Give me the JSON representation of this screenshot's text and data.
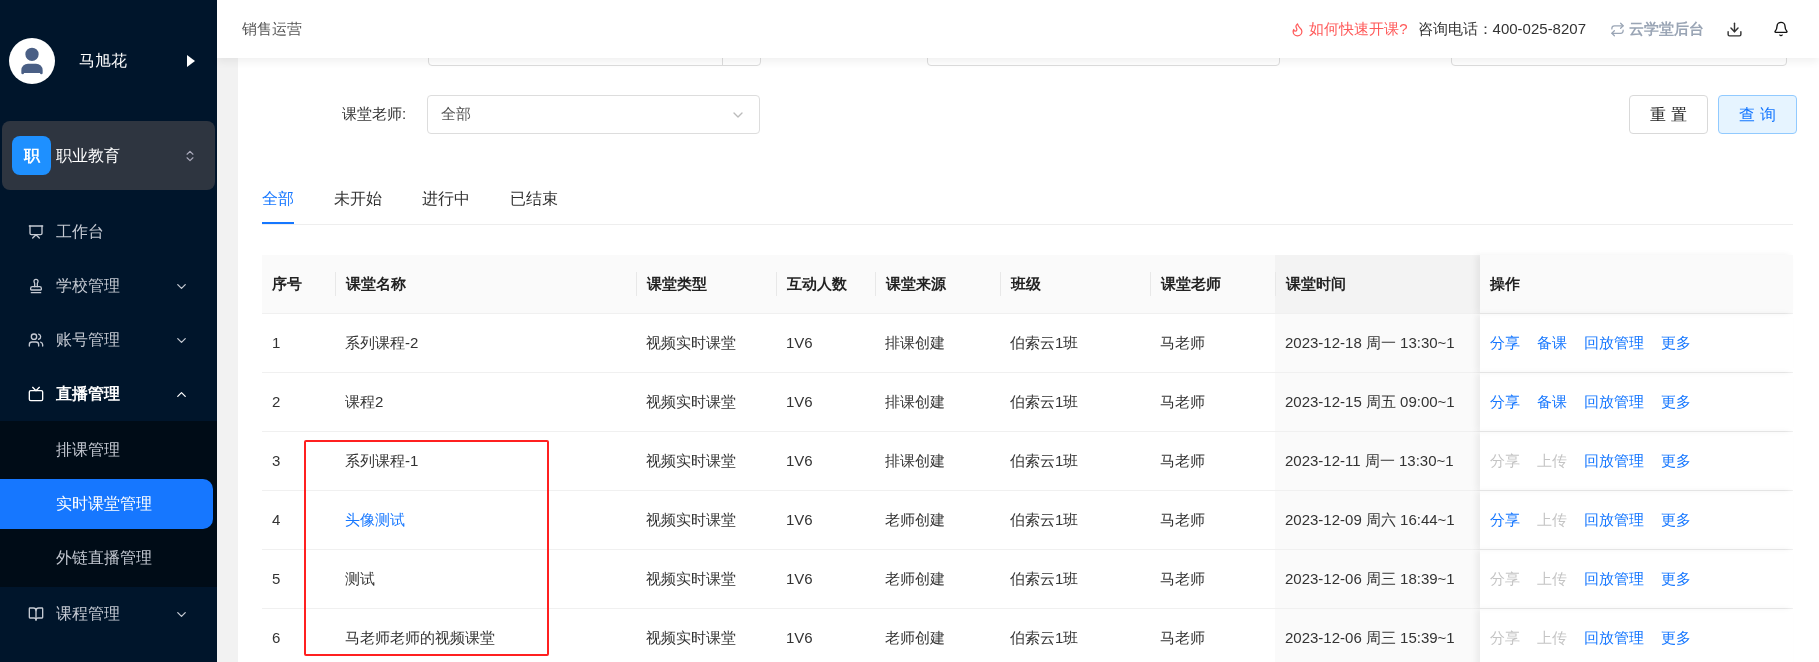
{
  "sidebar": {
    "user": {
      "name": "马旭花"
    },
    "org": {
      "badge": "职",
      "name": "职业教育"
    },
    "items": [
      {
        "kind": "workbench",
        "label": "工作台",
        "expanded": false,
        "has_children": false
      },
      {
        "kind": "school",
        "label": "学校管理",
        "expanded": false,
        "has_children": true
      },
      {
        "kind": "account",
        "label": "账号管理",
        "expanded": false,
        "has_children": true
      },
      {
        "kind": "live",
        "label": "直播管理",
        "expanded": true,
        "has_children": true,
        "children": [
          {
            "label": "排课管理",
            "selected": false
          },
          {
            "label": "实时课堂管理",
            "selected": true
          },
          {
            "label": "外链直播管理",
            "selected": false
          }
        ]
      },
      {
        "kind": "course",
        "label": "课程管理",
        "expanded": false,
        "has_children": true
      }
    ]
  },
  "header": {
    "breadcrumb": "销售运营",
    "help_link": "如何快速开课?",
    "phone": "咨询电话：400-025-8207",
    "backend_link": "云学堂后台"
  },
  "filters": {
    "teacher": {
      "label": "课堂老师:",
      "value": "全部"
    },
    "buttons": [
      {
        "kind": "reset",
        "label": "重 置"
      },
      {
        "kind": "query",
        "label": "查 询"
      }
    ]
  },
  "tabs": [
    {
      "label": "全部",
      "selected": true
    },
    {
      "label": "未开始",
      "selected": false
    },
    {
      "label": "进行中",
      "selected": false
    },
    {
      "label": "已结束",
      "selected": false
    }
  ],
  "table": {
    "columns": [
      "序号",
      "课堂名称",
      "课堂类型",
      "互动人数",
      "课堂来源",
      "班级",
      "课堂老师",
      "课堂时间",
      "操作"
    ],
    "rows": [
      {
        "cells": [
          "1",
          "系列课程-2",
          "视频实时课堂",
          "1V6",
          "排课创建",
          "伯索云1班",
          "马老师",
          "2023-12-18 周一 13:30~1"
        ],
        "name_link": false,
        "actions": [
          {
            "label": "分享",
            "disabled": false
          },
          {
            "label": "备课",
            "disabled": false
          },
          {
            "label": "回放管理",
            "disabled": false
          },
          {
            "label": "更多",
            "disabled": false
          }
        ]
      },
      {
        "cells": [
          "2",
          "课程2",
          "视频实时课堂",
          "1V6",
          "排课创建",
          "伯索云1班",
          "马老师",
          "2023-12-15 周五 09:00~1"
        ],
        "name_link": false,
        "actions": [
          {
            "label": "分享",
            "disabled": false
          },
          {
            "label": "备课",
            "disabled": false
          },
          {
            "label": "回放管理",
            "disabled": false
          },
          {
            "label": "更多",
            "disabled": false
          }
        ]
      },
      {
        "cells": [
          "3",
          "系列课程-1",
          "视频实时课堂",
          "1V6",
          "排课创建",
          "伯索云1班",
          "马老师",
          "2023-12-11 周一 13:30~1"
        ],
        "name_link": false,
        "actions": [
          {
            "label": "分享",
            "disabled": true
          },
          {
            "label": "上传",
            "disabled": true
          },
          {
            "label": "回放管理",
            "disabled": false
          },
          {
            "label": "更多",
            "disabled": false
          }
        ]
      },
      {
        "cells": [
          "4",
          "头像测试",
          "视频实时课堂",
          "1V6",
          "老师创建",
          "伯索云1班",
          "马老师",
          "2023-12-09 周六 16:44~1"
        ],
        "name_link": true,
        "actions": [
          {
            "label": "分享",
            "disabled": false
          },
          {
            "label": "上传",
            "disabled": true
          },
          {
            "label": "回放管理",
            "disabled": false
          },
          {
            "label": "更多",
            "disabled": false
          }
        ]
      },
      {
        "cells": [
          "5",
          "测试",
          "视频实时课堂",
          "1V6",
          "老师创建",
          "伯索云1班",
          "马老师",
          "2023-12-06 周三 18:39~1"
        ],
        "name_link": false,
        "actions": [
          {
            "label": "分享",
            "disabled": true
          },
          {
            "label": "上传",
            "disabled": true
          },
          {
            "label": "回放管理",
            "disabled": false
          },
          {
            "label": "更多",
            "disabled": false
          }
        ]
      },
      {
        "cells": [
          "6",
          "马老师老师的视频课堂",
          "视频实时课堂",
          "1V6",
          "老师创建",
          "伯索云1班",
          "马老师",
          "2023-12-06 周三 15:39~1"
        ],
        "name_link": false,
        "actions": [
          {
            "label": "分享",
            "disabled": true
          },
          {
            "label": "上传",
            "disabled": true
          },
          {
            "label": "回放管理",
            "disabled": false
          },
          {
            "label": "更多",
            "disabled": false
          }
        ]
      }
    ],
    "annotation_box": true
  }
}
